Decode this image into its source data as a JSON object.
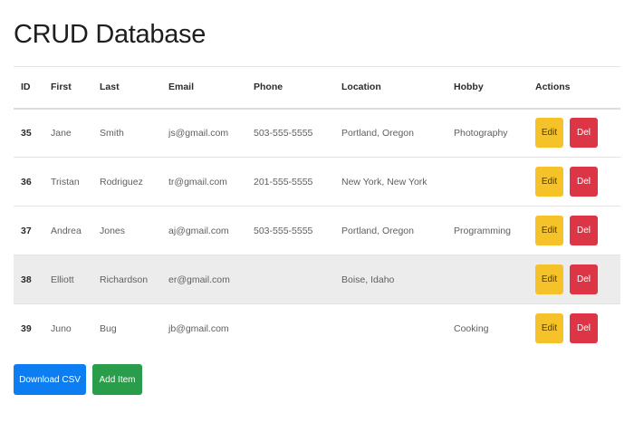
{
  "page": {
    "title": "CRUD Database"
  },
  "table": {
    "headers": [
      "ID",
      "First",
      "Last",
      "Email",
      "Phone",
      "Location",
      "Hobby",
      "Actions"
    ],
    "rows": [
      {
        "id": "35",
        "first": "Jane",
        "last": "Smith",
        "email": "js@gmail.com",
        "phone": "503-555-5555",
        "location": "Portland, Oregon",
        "hobby": "Photography",
        "edit": "Edit",
        "del": "Del"
      },
      {
        "id": "36",
        "first": "Tristan",
        "last": "Rodriguez",
        "email": "tr@gmail.com",
        "phone": "201-555-5555",
        "location": "New York, New York",
        "hobby": "",
        "edit": "Edit",
        "del": "Del"
      },
      {
        "id": "37",
        "first": "Andrea",
        "last": "Jones",
        "email": "aj@gmail.com",
        "phone": "503-555-5555",
        "location": "Portland, Oregon",
        "hobby": "Programming",
        "edit": "Edit",
        "del": "Del"
      },
      {
        "id": "38",
        "first": "Elliott",
        "last": "Richardson",
        "email": "er@gmail.com",
        "phone": "",
        "location": "Boise, Idaho",
        "hobby": "",
        "edit": "Edit",
        "del": "Del"
      },
      {
        "id": "39",
        "first": "Juno",
        "last": "Bug",
        "email": "jb@gmail.com",
        "phone": "",
        "location": "",
        "hobby": "Cooking",
        "edit": "Edit",
        "del": "Del"
      }
    ]
  },
  "buttons": {
    "download_csv": "Download CSV",
    "add_item": "Add Item"
  },
  "colors": {
    "primary": "#0d7ef2",
    "success": "#2a9d4a",
    "warning": "#f5c22a",
    "danger": "#dc3545",
    "row_highlight": "#ececec"
  }
}
